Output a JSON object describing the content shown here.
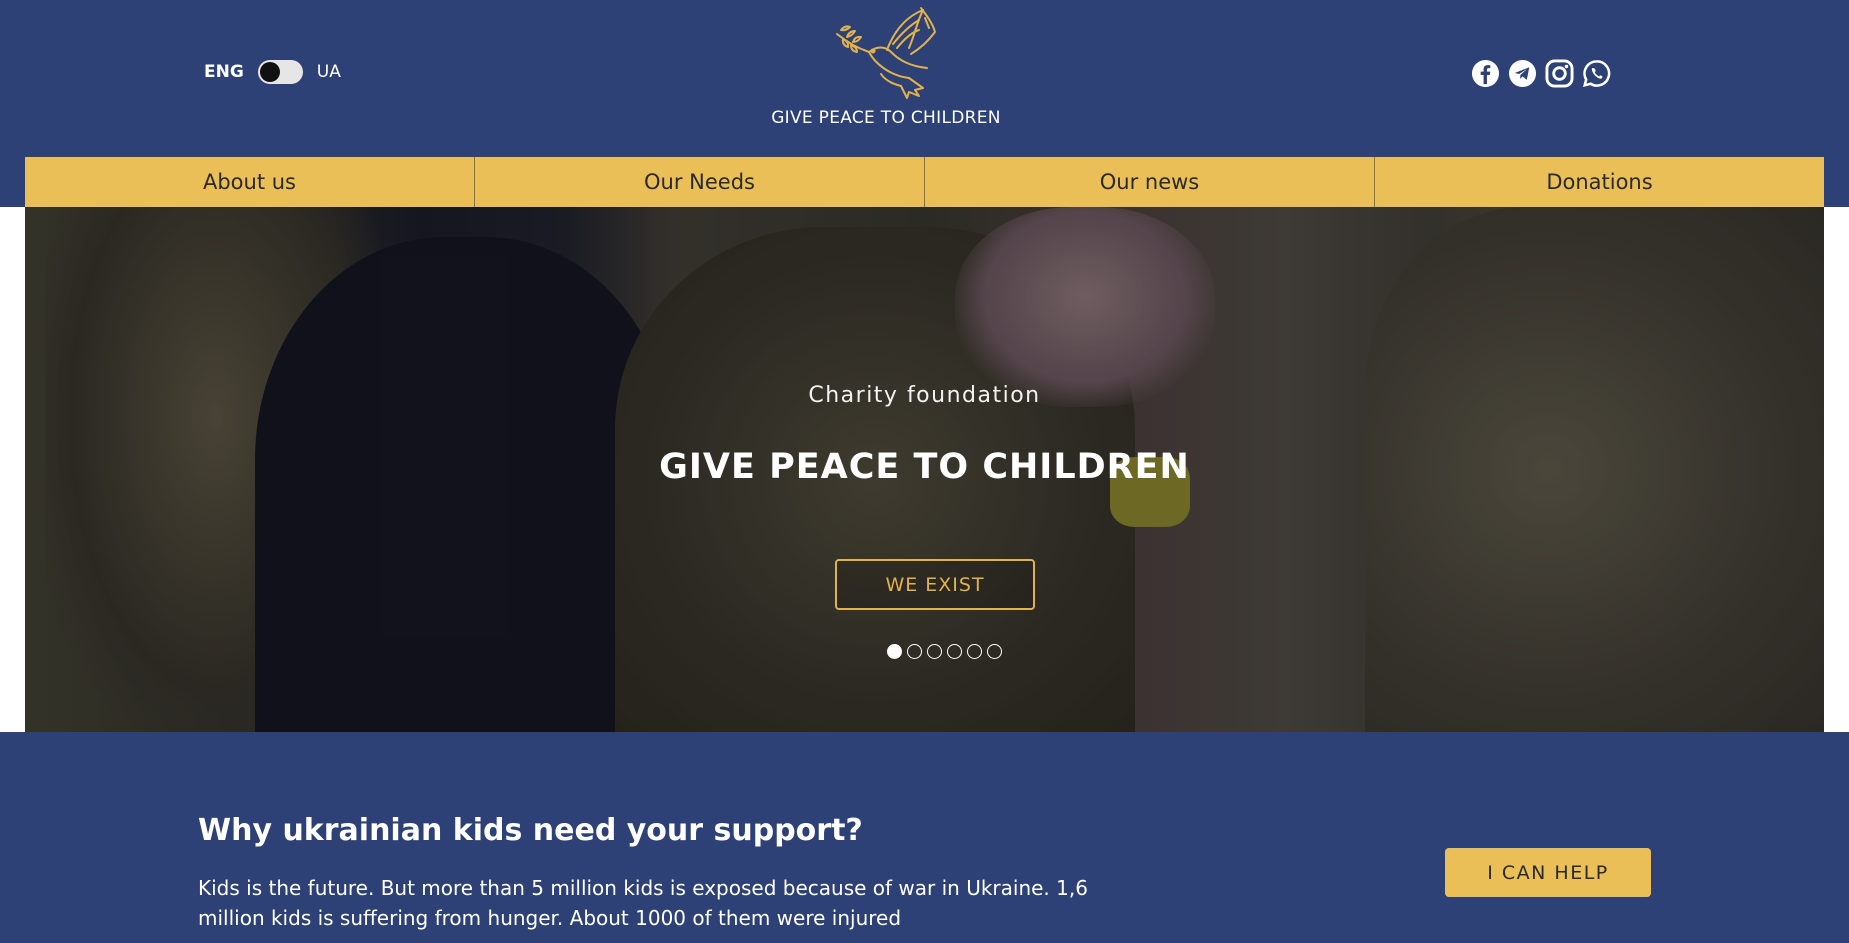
{
  "header": {
    "lang_left": "ENG",
    "lang_right": "UA",
    "logo_title": "GIVE PEACE TO CHILDREN",
    "social_icons": [
      "facebook-icon",
      "telegram-icon",
      "instagram-icon",
      "whatsapp-icon"
    ]
  },
  "nav": {
    "items": [
      {
        "label": "About us"
      },
      {
        "label": "Our Needs"
      },
      {
        "label": "Our news"
      },
      {
        "label": "Donations"
      }
    ]
  },
  "hero": {
    "subtitle": "Charity foundation",
    "title": "GIVE PEACE TO CHILDREN",
    "button_label": "WE EXIST",
    "slide_count": 6,
    "active_slide": 1
  },
  "support": {
    "title": "Why ukrainian kids need your support?",
    "text": "Kids is the future. But more than 5 million kids is exposed because of war in Ukraine. 1,6 million kids is suffering from hunger. About 1000 of them were injured",
    "button_label": "I CAN HELP"
  },
  "colors": {
    "background": "#2d4176",
    "accent": "#eabf57",
    "logo_gold": "#e2b24c"
  }
}
